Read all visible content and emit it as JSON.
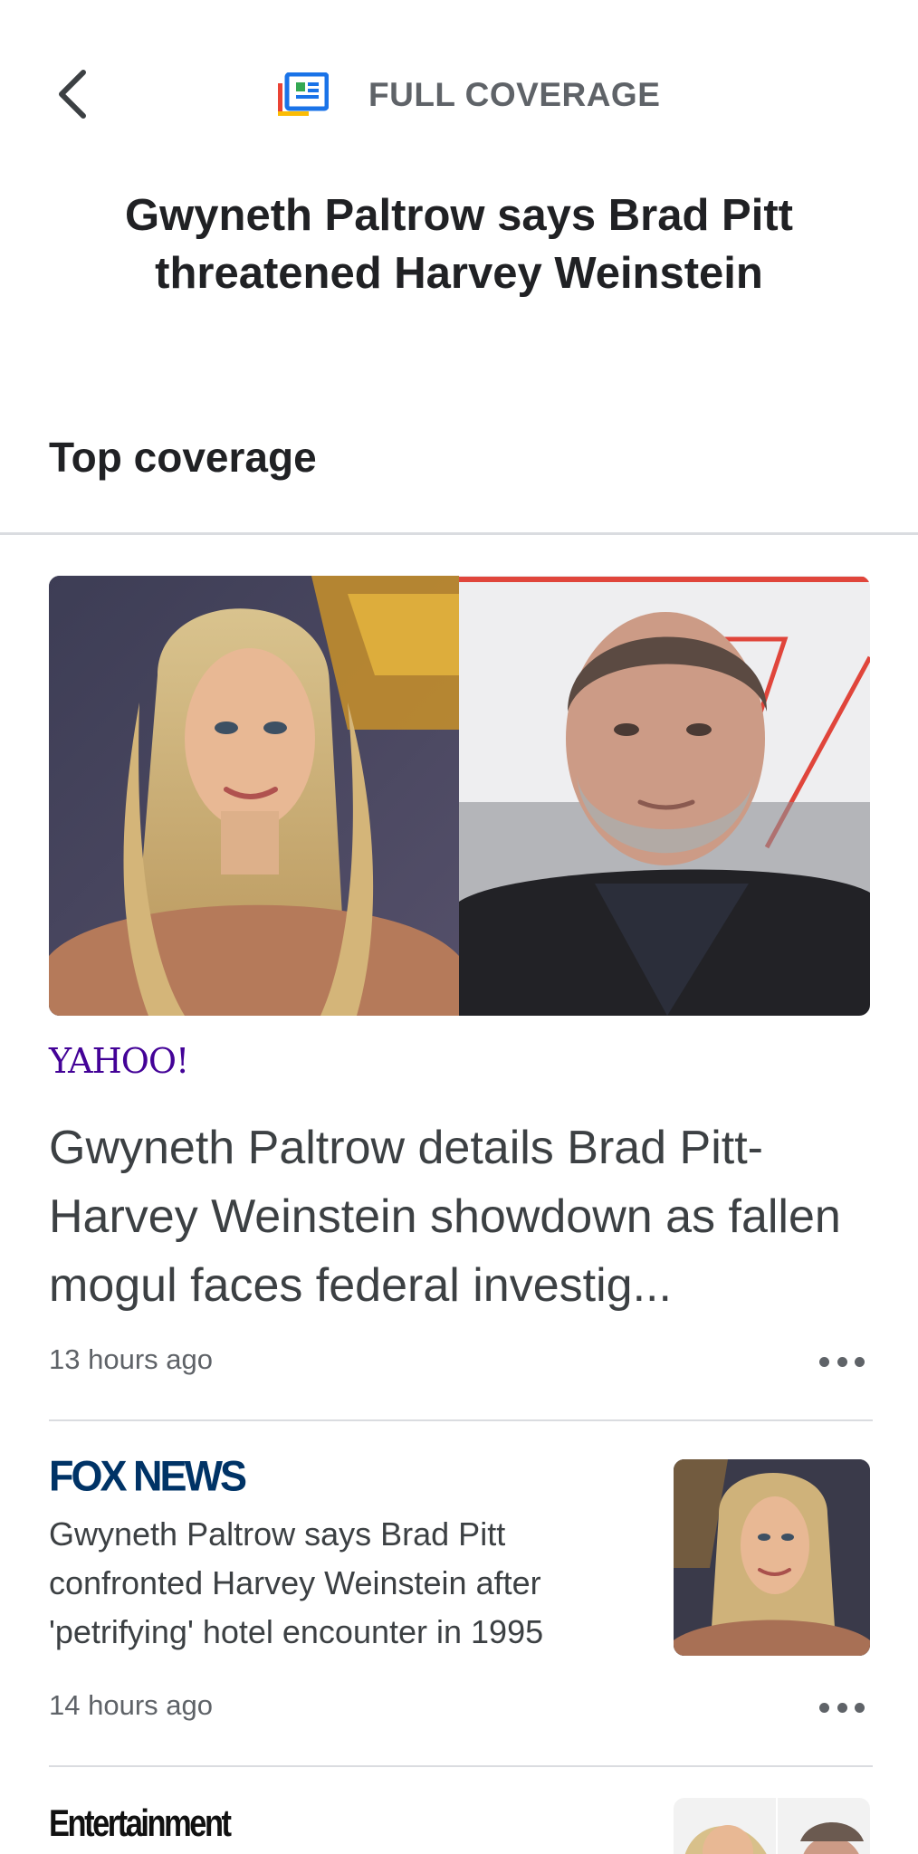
{
  "header": {
    "brand_label": "FULL COVERAGE"
  },
  "story": {
    "title": "Gwyneth Paltrow says Brad Pitt threatened Harvey Weinstein"
  },
  "section": {
    "title": "Top coverage"
  },
  "articles": [
    {
      "source": "YAHOO!",
      "headline": "Gwyneth Paltrow details Brad Pitt-Harvey Weinstein showdown as fallen mogul faces federal investig...",
      "time": "13 hours ago"
    },
    {
      "source": "FOX NEWS",
      "headline": "Gwyneth Paltrow says Brad Pitt confronted Harvey Weinstein after 'petrifying' hotel encounter in 1995",
      "time": "14 hours ago"
    },
    {
      "source": "Entertainment"
    }
  ],
  "colors": {
    "yahoo_purple": "#430297",
    "fox_blue": "#003366",
    "text_primary": "#202124",
    "text_secondary": "#5f6368",
    "divider": "#dadce0"
  },
  "icons": {
    "back": "chevron-left-icon",
    "brand": "full-coverage-icon",
    "more": "more-horiz-icon"
  }
}
